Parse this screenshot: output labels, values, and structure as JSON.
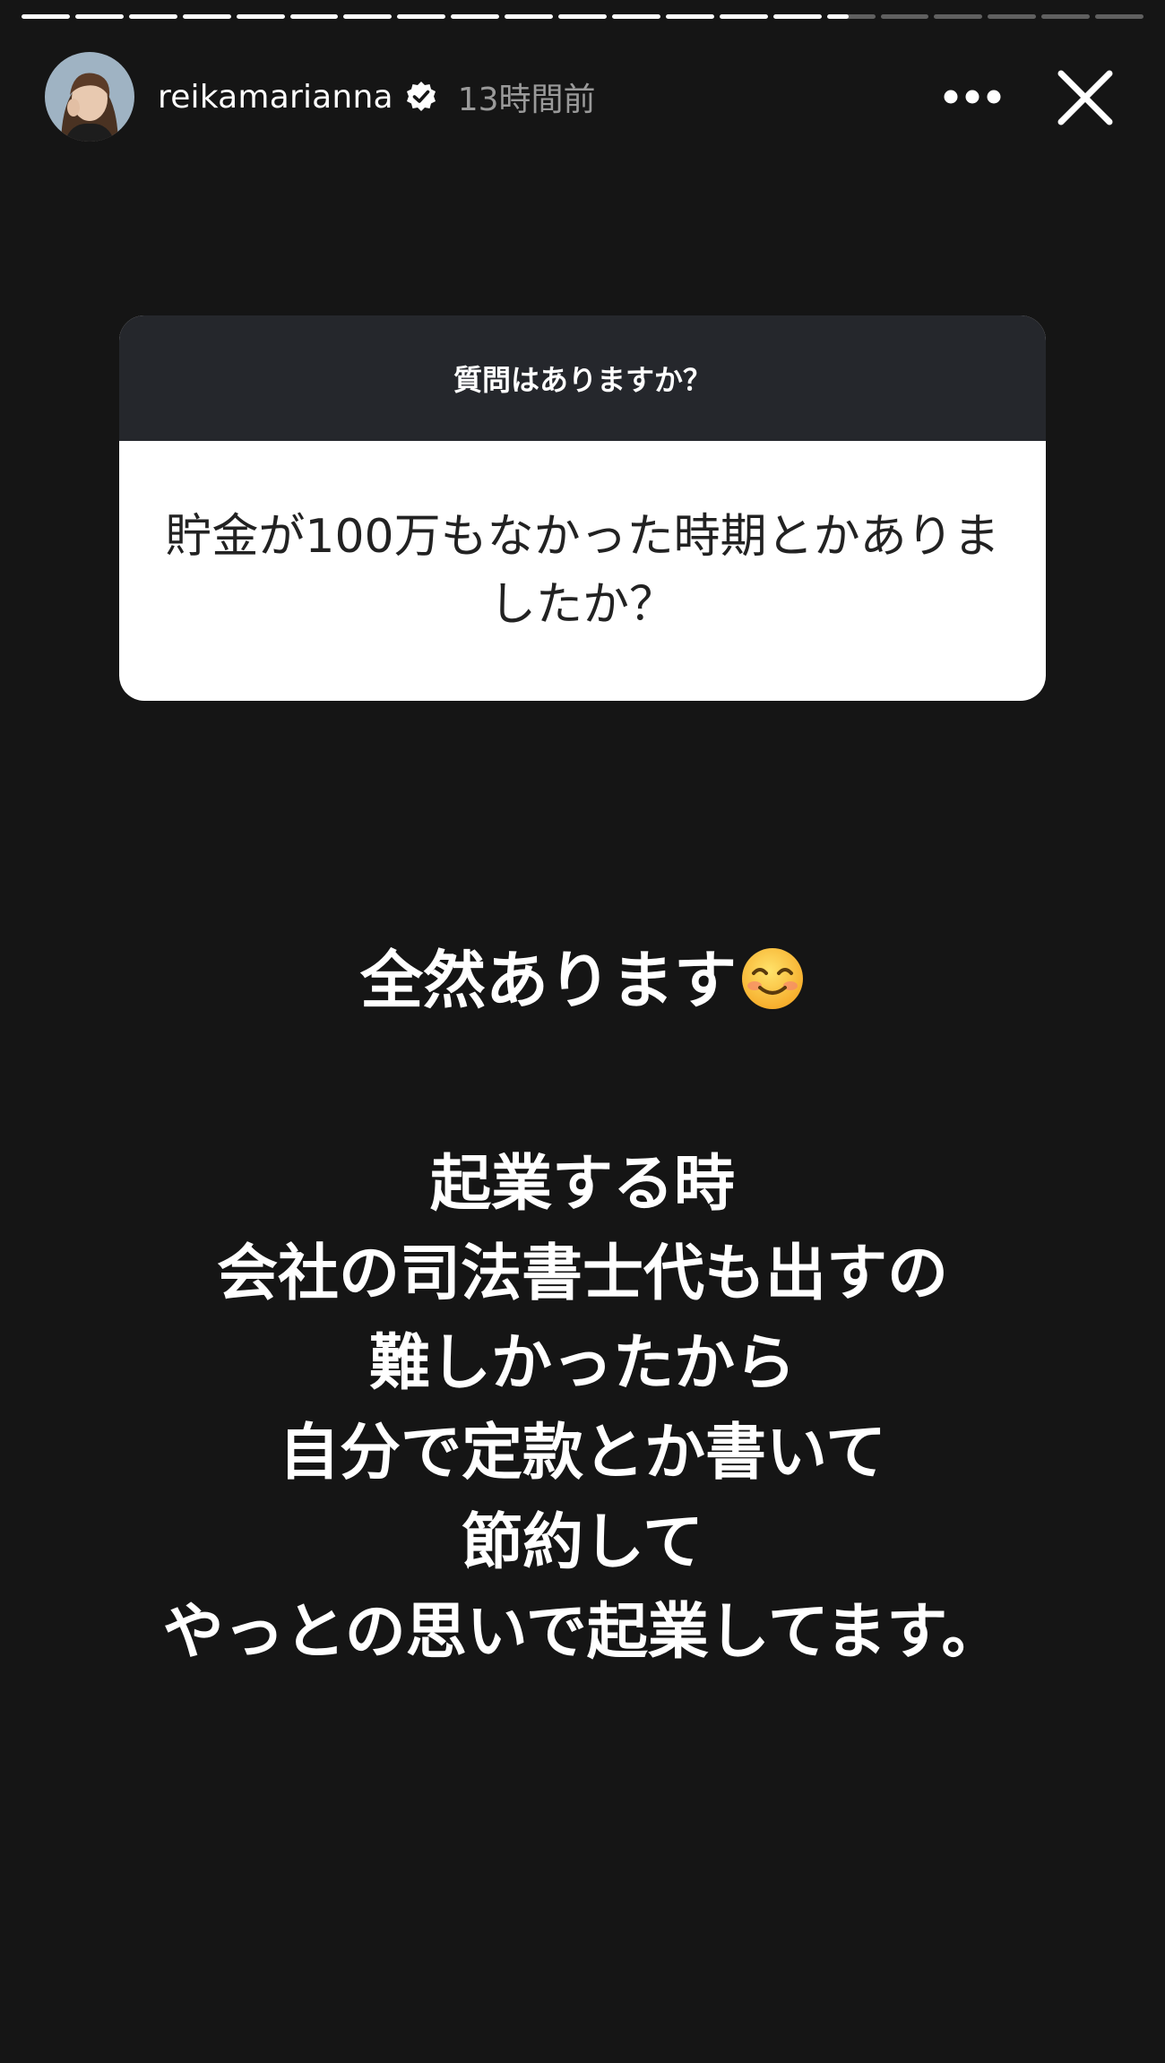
{
  "story": {
    "progress": {
      "segments_total": 21,
      "segments_viewed": 15,
      "current_segment_fraction": 0.45
    },
    "header": {
      "username": "reikamarianna",
      "verified": true,
      "timestamp": "13時間前",
      "icons": {
        "avatar": "profile-photo",
        "verified": "verified-badge-icon",
        "more": "more-options-icon",
        "close": "close-icon"
      }
    },
    "question_card": {
      "prompt": "質問はありますか？",
      "question": "貯金が100万もなかった時期とかありましたか？"
    },
    "answer": {
      "text": "全然あります",
      "emoji": "smiling-face-emoji"
    },
    "message": {
      "lines": [
        "起業する時",
        "会社の司法書士代も出すの",
        "難しかったから",
        "自分で定款とか書いて",
        "節約して",
        "やっとの思いで起業してます。"
      ]
    },
    "colors": {
      "background": "#151515",
      "card_header": "#25272c",
      "card_body": "#ffffff",
      "question_text": "#222222",
      "timestamp": "#9a9a9a"
    }
  }
}
